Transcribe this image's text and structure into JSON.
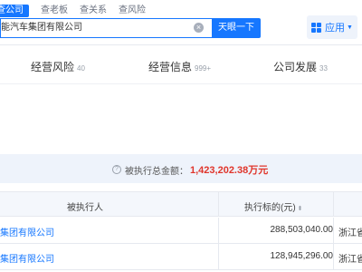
{
  "header": {
    "tabs": [
      {
        "label": "查公司",
        "active": true
      },
      {
        "label": "查老板",
        "active": false
      },
      {
        "label": "查关系",
        "active": false
      },
      {
        "label": "查风险",
        "active": false
      }
    ],
    "search_value": "能汽车集团有限公司",
    "search_button": "天眼一下",
    "apps_label": "应用",
    "accent_color": "#1677ff"
  },
  "nav": {
    "items": [
      {
        "label": "经营风险",
        "count": "40"
      },
      {
        "label": "经营信息",
        "count": "999+"
      },
      {
        "label": "公司发展",
        "count": "33"
      }
    ]
  },
  "summary": {
    "label": "被执行总金额：",
    "amount": "1,423,202.38万元"
  },
  "table": {
    "columns": [
      "被执行人",
      "执行标的(元)"
    ],
    "rows": [
      {
        "name": "集团有限公司",
        "amount": "288,503,040.00",
        "location": "浙江省"
      },
      {
        "name": "集团有限公司",
        "amount": "128,945,296.00",
        "location": "浙江省"
      }
    ]
  }
}
